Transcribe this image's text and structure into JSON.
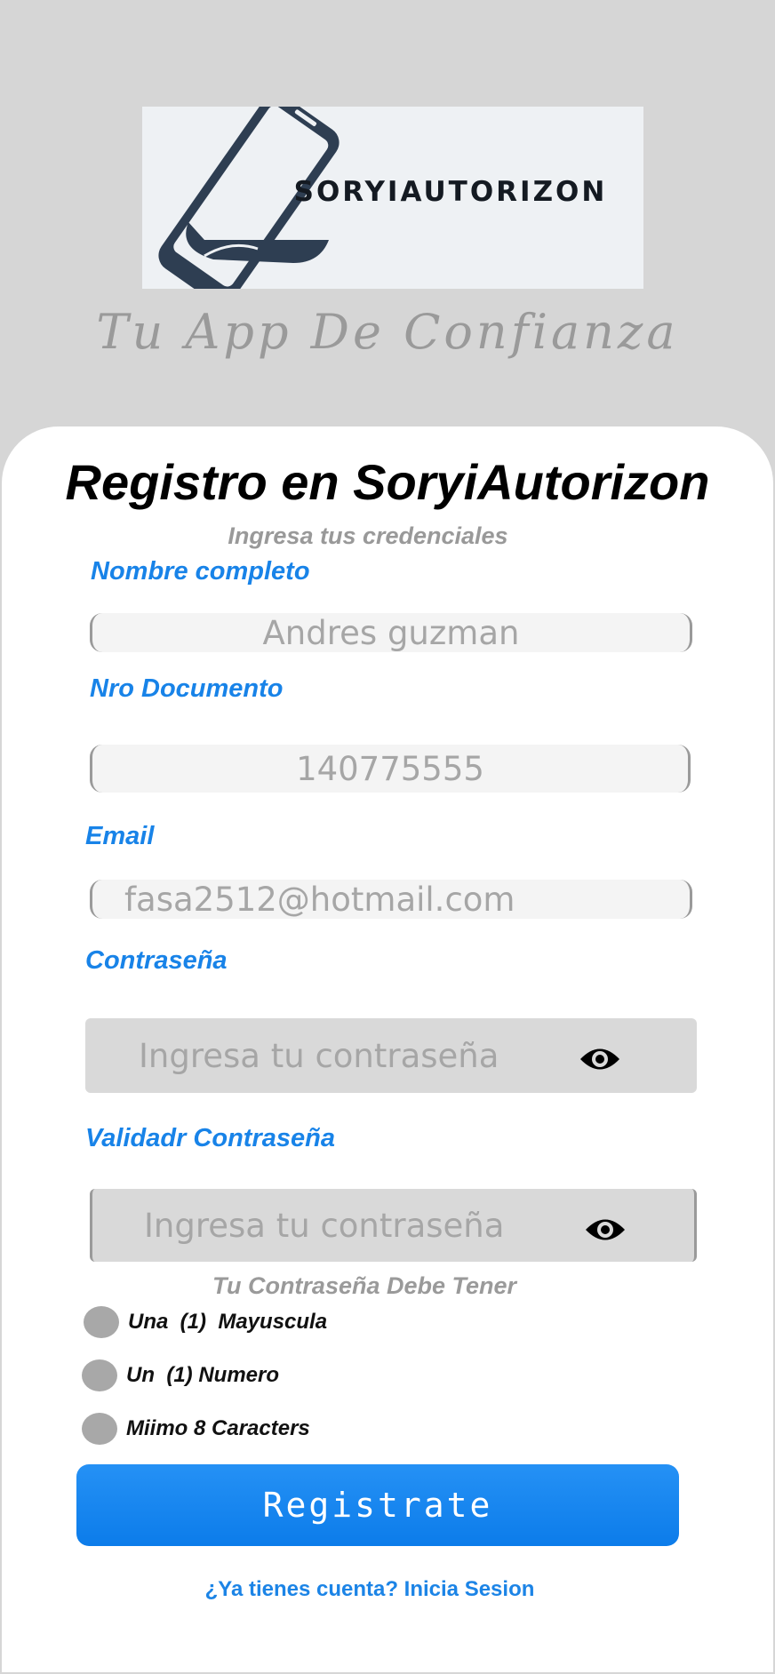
{
  "logo": {
    "brand_text": "SORYIAUTORIZON",
    "tagline": "Tu App De Confianza"
  },
  "form": {
    "title": "Registro en SoryiAutorizon",
    "subtitle": "Ingresa tus credenciales",
    "fields": {
      "name": {
        "label": "Nombre completo",
        "value": "Andres guzman"
      },
      "document": {
        "label": "Nro Documento",
        "value": "140775555"
      },
      "email": {
        "label": "Email",
        "value": "fasa2512@hotmail.com"
      },
      "password": {
        "label": "Contraseña",
        "placeholder": "Ingresa tu contraseña"
      },
      "confirm_password": {
        "label": "Validadr Contraseña",
        "placeholder": "Ingresa tu contraseña"
      }
    },
    "requirements": {
      "title": "Tu Contraseña Debe Tener",
      "items": [
        {
          "text": "Una  (1)  Mayuscula",
          "met": false
        },
        {
          "text": "Un  (1) Numero",
          "met": false
        },
        {
          "text": "Miimo 8 Caracters",
          "met": false
        }
      ]
    },
    "register_button": "Registrate",
    "login_link": "¿Ya tienes cuenta? Inicia Sesion"
  },
  "icons": {
    "logo": "phone-logo-icon",
    "password_toggle": "eye-icon"
  },
  "colors": {
    "background": "#d6d6d6",
    "card": "#ffffff",
    "accent": "#1883e8",
    "button": "#0c7cea",
    "requirement_dot": "#a8a8a8"
  }
}
